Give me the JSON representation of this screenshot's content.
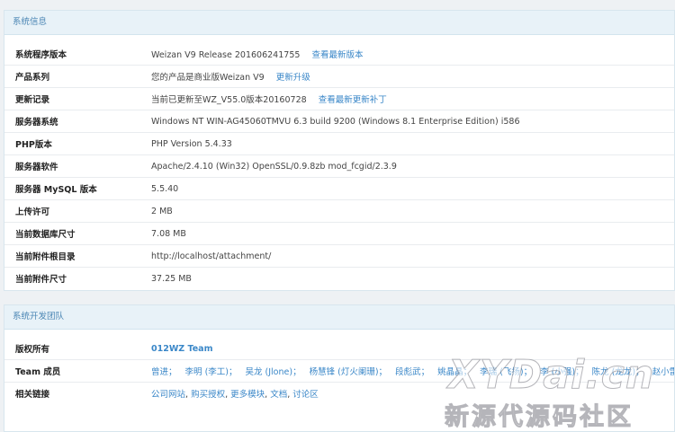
{
  "system_info": {
    "title": "系统信息",
    "rows": [
      {
        "label": "系统程序版本",
        "value": "Weizan V9 Release 201606241755",
        "link": "查看最新版本"
      },
      {
        "label": "产品系列",
        "value": "您的产品是商业版Weizan V9",
        "link": "更新升级"
      },
      {
        "label": "更新记录",
        "value": "当前已更新至WZ_V55.0版本20160728",
        "link": "查看最新更新补丁"
      },
      {
        "label": "服务器系统",
        "value": "Windows NT WIN-AG45060TMVU 6.3 build 9200 (Windows 8.1 Enterprise Edition) i586"
      },
      {
        "label": "PHP版本",
        "value": "PHP Version 5.4.33"
      },
      {
        "label": "服务器软件",
        "value": "Apache/2.4.10 (Win32) OpenSSL/0.9.8zb mod_fcgid/2.3.9"
      },
      {
        "label": "服务器 MySQL 版本",
        "value": "5.5.40"
      },
      {
        "label": "上传许可",
        "value": "2 MB"
      },
      {
        "label": "当前数据库尺寸",
        "value": "7.08 MB"
      },
      {
        "label": "当前附件根目录",
        "value": "http://localhost/attachment/"
      },
      {
        "label": "当前附件尺寸",
        "value": "37.25 MB"
      }
    ]
  },
  "dev_team": {
    "title": "系统开发团队",
    "copyright_label": "版权所有",
    "copyright_value": "012WZ Team",
    "members_label": "Team 成员",
    "members": [
      "曾进；",
      "李明 (李工)；",
      "吴龙 (Jlone)；",
      "杨慧锋 (灯火阑珊)；",
      "段彪武；",
      "姚晶晶；",
      "李瑞 (飞扬)；",
      "李 (小强)；",
      "陈龙 (龙龙)；",
      "赵小雷 (微微)；"
    ],
    "links_label": "相关链接",
    "links": [
      "公司网站",
      "购买授权",
      "更多模块",
      "文档",
      "讨论区"
    ],
    "links_separator": ", "
  },
  "watermark": {
    "main": "XYDai.cn",
    "sub": "新源代源码社区"
  }
}
